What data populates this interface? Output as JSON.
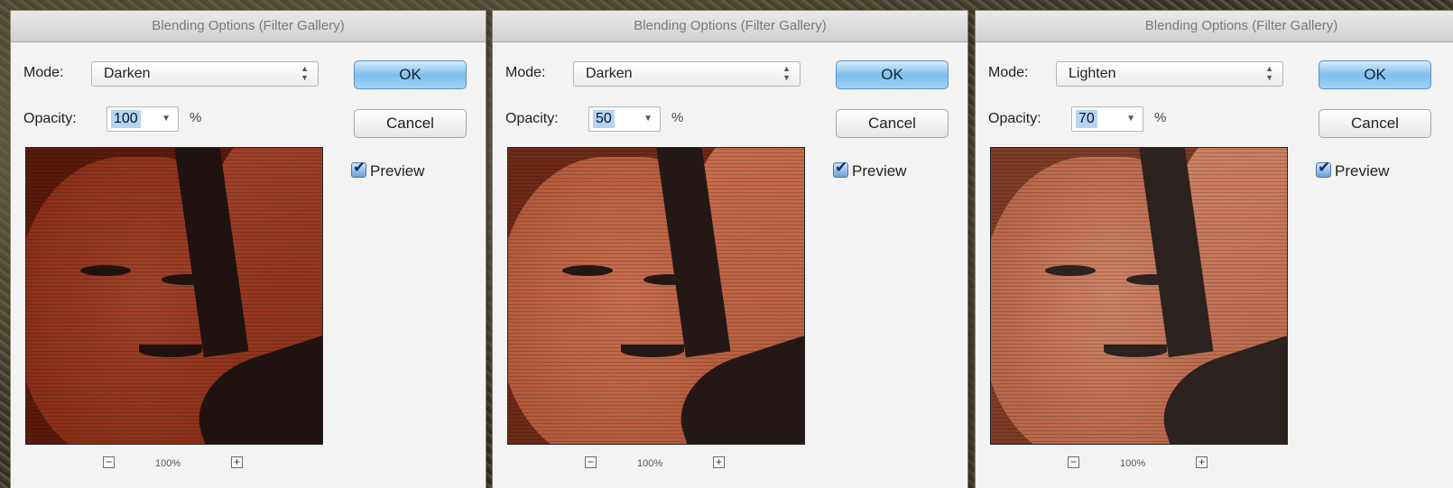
{
  "dialogs": [
    {
      "title": "Blending Options (Filter Gallery)",
      "mode_label": "Mode:",
      "mode_value": "Darken",
      "opacity_label": "Opacity:",
      "opacity_value": "100",
      "opacity_unit": "%",
      "ok_label": "OK",
      "cancel_label": "Cancel",
      "preview_label": "Preview",
      "preview_checked": true,
      "zoom_out_glyph": "−",
      "zoom_level": "100%",
      "zoom_in_glyph": "+",
      "image_palette": {
        "skin": "#8c2f18",
        "skin2": "#a1442a",
        "dark": "#1f1210",
        "accent": "#5a1a0c"
      }
    },
    {
      "title": "Blending Options (Filter Gallery)",
      "mode_label": "Mode:",
      "mode_value": "Darken",
      "opacity_label": "Opacity:",
      "opacity_value": "50",
      "opacity_unit": "%",
      "ok_label": "OK",
      "cancel_label": "Cancel",
      "preview_label": "Preview",
      "preview_checked": true,
      "zoom_out_glyph": "−",
      "zoom_level": "100%",
      "zoom_in_glyph": "+",
      "image_palette": {
        "skin": "#b45a3c",
        "skin2": "#c96f50",
        "dark": "#241816",
        "accent": "#6e2a18"
      }
    },
    {
      "title": "Blending Options (Filter Gallery)",
      "mode_label": "Mode:",
      "mode_value": "Lighten",
      "opacity_label": "Opacity:",
      "opacity_value": "70",
      "opacity_unit": "%",
      "ok_label": "OK",
      "cancel_label": "Cancel",
      "preview_label": "Preview",
      "preview_checked": true,
      "zoom_out_glyph": "−",
      "zoom_level": "100%",
      "zoom_in_glyph": "+",
      "image_palette": {
        "skin": "#b9674a",
        "skin2": "#cf8466",
        "dark": "#2c2220",
        "accent": "#7c3c26"
      }
    }
  ]
}
